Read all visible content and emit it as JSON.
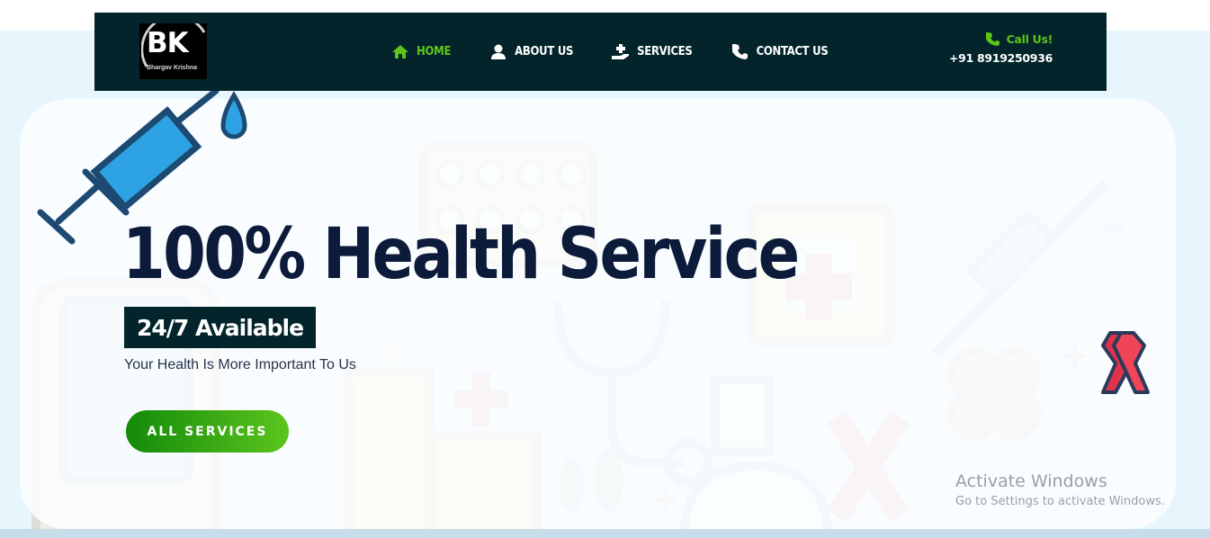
{
  "brand": {
    "logo_text": "BK",
    "logo_subtitle": "Bhargav Krishna"
  },
  "nav": {
    "items": [
      {
        "label": "HOME",
        "icon": "home-icon",
        "active": true
      },
      {
        "label": "ABOUT US",
        "icon": "user-icon",
        "active": false
      },
      {
        "label": "SERVICES",
        "icon": "hand-medical-icon",
        "active": false
      },
      {
        "label": "CONTACT US",
        "icon": "phone-icon",
        "active": false
      }
    ]
  },
  "call": {
    "label": "Call Us!",
    "phone": "+91 8919250936",
    "icon": "phone-icon"
  },
  "hero": {
    "title": "100% Health Service",
    "badge": "24/7 Available",
    "tagline": "Your Health Is More Important To Us",
    "button_label": "ALL SERVICES"
  },
  "watermark": {
    "title": "Activate Windows",
    "subtitle": "Go to Settings to activate Windows."
  },
  "colors": {
    "header_bg": "#03242b",
    "accent_green": "#5ec41a",
    "title_navy": "#0c1b3a",
    "hero_bg": "#e6f6fc"
  }
}
